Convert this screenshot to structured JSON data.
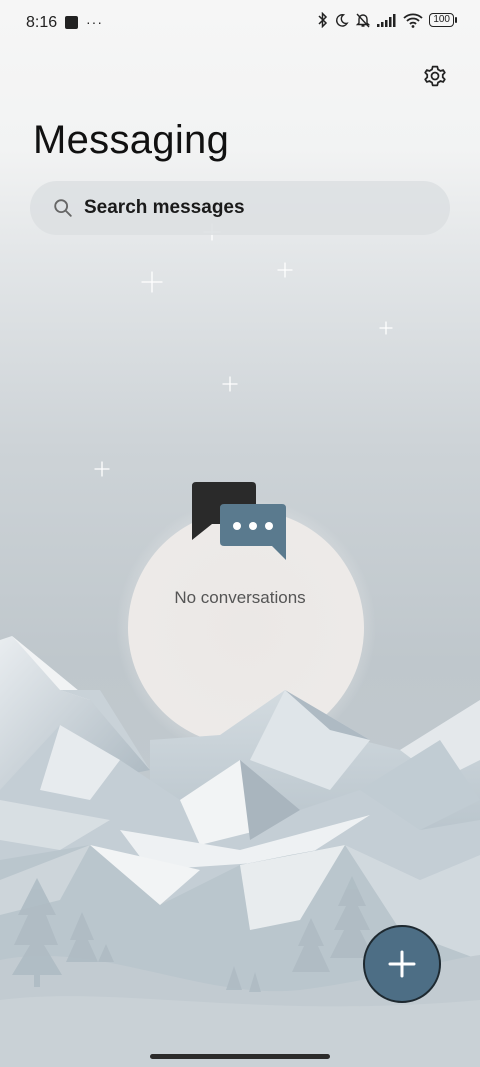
{
  "status_bar": {
    "time": "8:16",
    "battery": "100"
  },
  "header": {
    "title": "Messaging"
  },
  "search": {
    "placeholder": "Search messages"
  },
  "empty_state": {
    "message": "No conversations"
  },
  "colors": {
    "accent": "#4d6e85",
    "bubble_dark": "#2a2a2a",
    "bubble_light": "#5a7a8e",
    "moon": "#ebe8e6"
  },
  "icons": {
    "settings": "gear-icon",
    "search": "search-icon",
    "fab": "plus-icon",
    "empty": "chat-bubbles-icon"
  }
}
